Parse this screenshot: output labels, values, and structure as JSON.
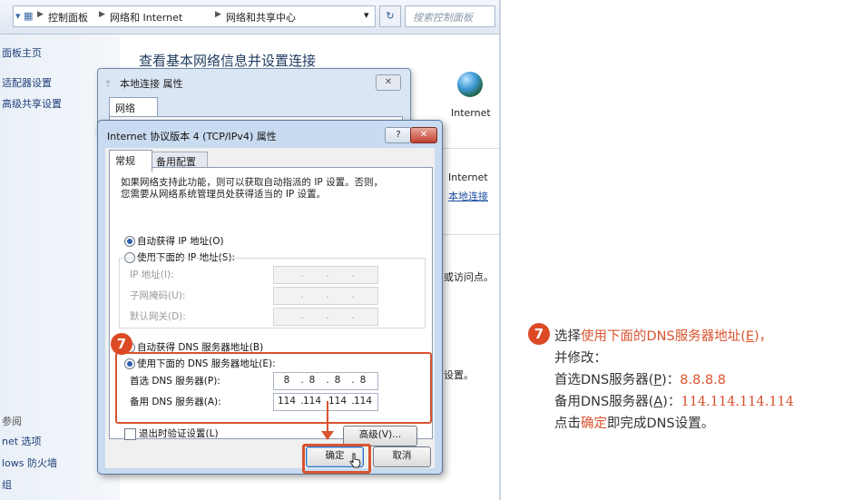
{
  "explorer": {
    "breadcrumbs": [
      "控制面板",
      "网络和 Internet",
      "网络和共享中心"
    ],
    "search_placeholder": "搜索控制面板",
    "sidebar": {
      "links": [
        "面板主页",
        "适配器设置",
        "高级共享设置"
      ],
      "see_also_heading": "参阅",
      "bottom_links": [
        "net 选项",
        "lows 防火墙",
        "组"
      ]
    },
    "main_title": "查看基本网络信息并设置连接",
    "network_map": {
      "internet_label": "Internet"
    },
    "active_network": {
      "access_type": "Internet",
      "connection_link": "本地连接"
    },
    "truncated": {
      "line1": "或访问点。",
      "line2": "设置。"
    }
  },
  "back_dialog": {
    "title": "本地连接 属性",
    "close_label": "✕",
    "tab": "网络"
  },
  "ipv4_dialog": {
    "title": "Internet 协议版本 4 (TCP/IPv4) 属性",
    "help_label": "?",
    "close_label": "✕",
    "tabs": [
      "常规",
      "备用配置"
    ],
    "description_lines": [
      "如果网络支持此功能，则可以获取自动指派的 IP 设置。否则，",
      "您需要从网络系统管理员处获得适当的 IP 设置。"
    ],
    "ip_auto": "自动获得 IP 地址(O)",
    "ip_manual": "使用下面的 IP 地址(S):",
    "ip_fields": {
      "ip_label": "IP 地址(I):",
      "mask_label": "子网掩码(U):",
      "gateway_label": "默认网关(D):"
    },
    "dns_auto": "自动获得 DNS 服务器地址(B)",
    "dns_manual": "使用下面的 DNS 服务器地址(E):",
    "preferred_dns_label": "首选 DNS 服务器(P):",
    "preferred_dns": [
      "8",
      "8",
      "8",
      "8"
    ],
    "alternate_dns_label": "备用 DNS 服务器(A):",
    "alternate_dns": [
      "114",
      "114",
      "114",
      "114"
    ],
    "validate_on_exit": "退出时验证设置(L)",
    "advanced_button": "高级(V)...",
    "ok_button": "确定",
    "cancel_button": "取消",
    "selected": {
      "ip_mode": "auto",
      "dns_mode": "manual",
      "validate_on_exit": false
    }
  },
  "annotation": {
    "step_number": "7",
    "line1_prefix": "选择",
    "line1_highlight": "使用下面的DNS服务器地址(",
    "line1_key": "E",
    "line1_suffix": ")，",
    "line2": "并修改：",
    "line3_prefix": "首选DNS服务器(",
    "line3_key": "P",
    "line3_mid": ")：",
    "line3_value": "8.8.8.8",
    "line4_prefix": "备用DNS服务器(",
    "line4_key": "A",
    "line4_mid": ")：",
    "line4_value": "114.114.114.114",
    "line5_prefix": "点击",
    "line5_highlight": "确定",
    "line5_suffix": "即完成DNS设置。"
  },
  "colors": {
    "highlight": "#d9532f",
    "badge": "#dc4a25",
    "dialog_frame": "#c9dbf0"
  }
}
